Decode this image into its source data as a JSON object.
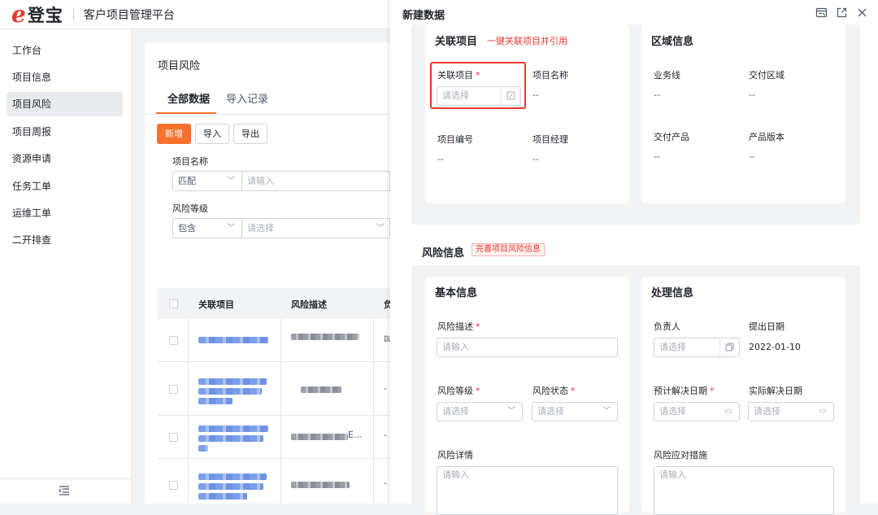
{
  "app": {
    "logo_e": "e",
    "logo_name": "登宝",
    "title": "客户项目管理平台"
  },
  "sidebar": {
    "items": [
      {
        "label": "工作台"
      },
      {
        "label": "项目信息"
      },
      {
        "label": "项目风险"
      },
      {
        "label": "项目周报"
      },
      {
        "label": "资源申请"
      },
      {
        "label": "任务工单"
      },
      {
        "label": "运维工单"
      },
      {
        "label": "二开排查"
      }
    ],
    "active_index": 2,
    "collapse_icon": "collapse-menu-icon"
  },
  "main": {
    "breadcrumb": "项目风险",
    "tabs": [
      {
        "label": "全部数据"
      },
      {
        "label": "导入记录"
      }
    ],
    "buttons": {
      "add": "新增",
      "import": "导入",
      "export": "导出"
    },
    "filters": {
      "project_name": {
        "label": "项目名称",
        "operator": "匹配",
        "placeholder": "请输入"
      },
      "risk_level": {
        "label": "风险等级",
        "operator": "包含",
        "placeholder": "请选择"
      }
    },
    "table": {
      "headers": [
        "关联项目",
        "风险描述",
        "负"
      ],
      "rows": [
        {
          "c3": "叫"
        },
        {
          "c3": "-"
        },
        {
          "c3": "-",
          "desc_suffix": "E..."
        },
        {
          "c3": "-"
        }
      ]
    }
  },
  "drawer": {
    "title": "新建数据",
    "icons": [
      "form-view-icon",
      "open-external-icon",
      "close-icon"
    ],
    "project": {
      "title": "关联项目",
      "link": "一键关联项目并引用",
      "fields": {
        "related": {
          "label": "关联项目",
          "placeholder": "请选择"
        },
        "name": {
          "label": "项目名称",
          "value": "--"
        },
        "code": {
          "label": "项目编号",
          "value": "--"
        },
        "manager": {
          "label": "项目经理",
          "value": "--"
        }
      }
    },
    "region": {
      "title": "区域信息",
      "fields": {
        "business": {
          "label": "业务线",
          "value": "--"
        },
        "area": {
          "label": "交付区域",
          "value": "--"
        },
        "product": {
          "label": "交付产品",
          "value": "--"
        },
        "version": {
          "label": "产品版本",
          "value": "--"
        }
      }
    },
    "risk": {
      "title": "风险信息",
      "tag": "完善项目风险信息",
      "basic": {
        "title": "基本信息",
        "desc": {
          "label": "风险描述",
          "placeholder": "请输入"
        },
        "level": {
          "label": "风险等级",
          "placeholder": "请选择"
        },
        "status": {
          "label": "风险状态",
          "placeholder": "请选择"
        },
        "detail": {
          "label": "风险详情",
          "placeholder": "请输入"
        }
      },
      "handle": {
        "title": "处理信息",
        "owner": {
          "label": "负责人",
          "placeholder": "请选择"
        },
        "date": {
          "label": "提出日期",
          "value": "2022-01-10"
        },
        "plan": {
          "label": "预计解决日期",
          "placeholder": "请选择"
        },
        "actual": {
          "label": "实际解决日期",
          "placeholder": "请选择"
        },
        "measure": {
          "label": "风险应对措施",
          "placeholder": "请输入"
        }
      }
    }
  },
  "colors": {
    "accent": "#f5712c",
    "brand_red": "#e8382e"
  }
}
